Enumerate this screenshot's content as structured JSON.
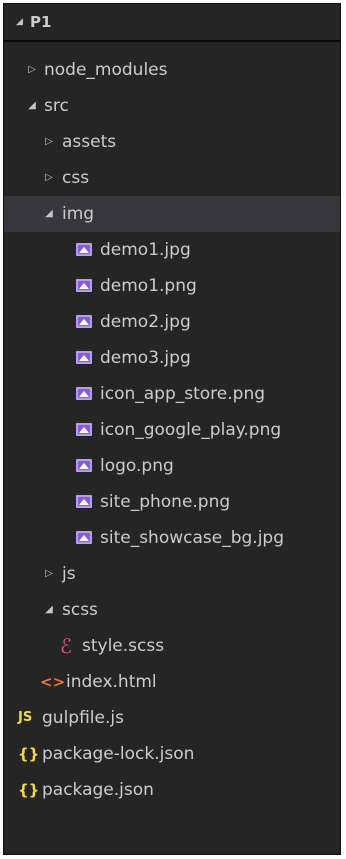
{
  "explorer": {
    "project": "P1",
    "items": [
      {
        "label": "node_modules",
        "type": "folder",
        "expanded": false
      },
      {
        "label": "src",
        "type": "folder",
        "expanded": true
      },
      {
        "label": "assets",
        "type": "folder",
        "expanded": false
      },
      {
        "label": "css",
        "type": "folder",
        "expanded": false
      },
      {
        "label": "img",
        "type": "folder",
        "expanded": true,
        "selected": true
      },
      {
        "label": "demo1.jpg",
        "type": "image"
      },
      {
        "label": "demo1.png",
        "type": "image"
      },
      {
        "label": "demo2.jpg",
        "type": "image"
      },
      {
        "label": "demo3.jpg",
        "type": "image"
      },
      {
        "label": "icon_app_store.png",
        "type": "image"
      },
      {
        "label": "icon_google_play.png",
        "type": "image"
      },
      {
        "label": "logo.png",
        "type": "image"
      },
      {
        "label": "site_phone.png",
        "type": "image"
      },
      {
        "label": "site_showcase_bg.jpg",
        "type": "image"
      },
      {
        "label": "js",
        "type": "folder",
        "expanded": false
      },
      {
        "label": "scss",
        "type": "folder",
        "expanded": true
      },
      {
        "label": "style.scss",
        "type": "sass"
      },
      {
        "label": "index.html",
        "type": "html"
      },
      {
        "label": "gulpfile.js",
        "type": "js",
        "icon_text": "JS"
      },
      {
        "label": "package-lock.json",
        "type": "json",
        "icon_text": "{}"
      },
      {
        "label": "package.json",
        "type": "json",
        "icon_text": "{}"
      }
    ]
  },
  "colors": {
    "background": "#252526",
    "text": "#cccccc",
    "selected_row": "#37373d",
    "image_icon": "#8a5bd6",
    "sass_icon": "#e0507a",
    "html_icon": "#e37933",
    "js_icon": "#f0d94a"
  }
}
